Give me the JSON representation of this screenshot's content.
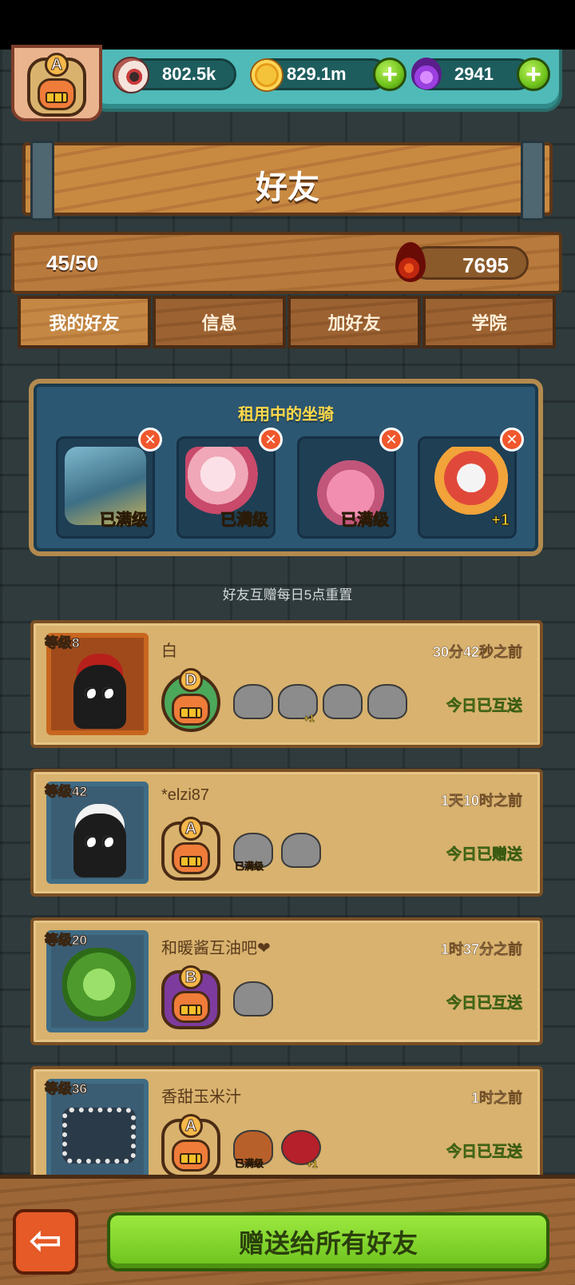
{
  "resources": {
    "eyes": "802.5k",
    "coins": "829.1m",
    "potions": "2941"
  },
  "player": {
    "rank": "A"
  },
  "page_title": "好友",
  "friend_count": "45/50",
  "blood_count": "7695",
  "tabs": [
    "我的好友",
    "信息",
    "加好友",
    "学院"
  ],
  "active_tab": "我的好友",
  "mount_panel": {
    "title": "租用中的坐骑",
    "slots": [
      {
        "label": "已满级"
      },
      {
        "label": "已满级"
      },
      {
        "label": "已满级"
      },
      {
        "label": "+1"
      }
    ]
  },
  "reset_note": "好友互赠每日5点重置",
  "friends": [
    {
      "level": "等级8",
      "name": "白",
      "time": "30分42秒之前",
      "status": "今日已互送",
      "rank": "D",
      "mounts": [
        {
          "label": ""
        },
        {
          "label": "+1"
        },
        {
          "label": ""
        },
        {
          "label": ""
        }
      ]
    },
    {
      "level": "等级42",
      "name": "*elzi87",
      "time": "1天10时之前",
      "status": "今日已赠送",
      "rank": "A",
      "mounts": [
        {
          "label": "已满级"
        },
        {
          "label": ""
        }
      ]
    },
    {
      "level": "等级20",
      "name": "和暖酱互油吧❤",
      "time": "1时37分之前",
      "status": "今日已互送",
      "rank": "B",
      "mounts": [
        {
          "label": ""
        }
      ]
    },
    {
      "level": "等级36",
      "name": "香甜玉米汁",
      "time": "1时之前",
      "status": "今日已互送",
      "rank": "A",
      "mounts": [
        {
          "label": "已满级"
        },
        {
          "label": "+1"
        }
      ]
    }
  ],
  "bottom": {
    "back_icon": "back-arrow-icon",
    "send_all_label": "赠送给所有好友"
  },
  "colors": {
    "panel_blue": "#2c5772",
    "status_green": "#8ce436",
    "gold_text": "#ffd84a",
    "button_green": "#6dc21d"
  }
}
